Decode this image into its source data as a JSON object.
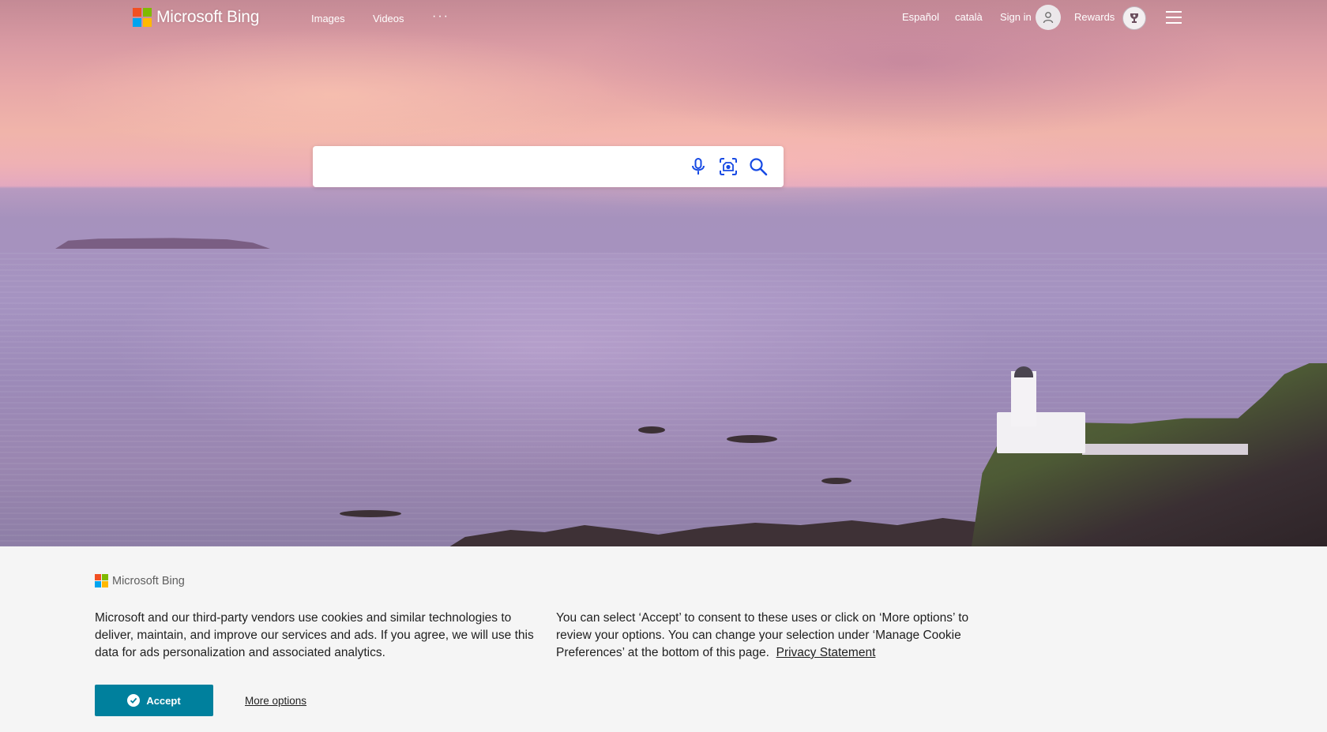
{
  "header": {
    "logo_text": "Microsoft Bing",
    "nav": {
      "images": "Images",
      "videos": "Videos",
      "more": "···"
    },
    "languages": [
      "Español",
      "català"
    ],
    "sign_in": "Sign in",
    "rewards": "Rewards"
  },
  "search": {
    "value": "",
    "icons": [
      "microphone-icon",
      "visual-search-icon",
      "search-icon"
    ]
  },
  "cookie_banner": {
    "logo_text": "Microsoft Bing",
    "paragraph_left": "Microsoft and our third-party vendors use cookies and similar technologies to deliver, maintain, and improve our services and ads. If you agree, we will use this data for ads personalization and associated analytics.",
    "paragraph_right": "You can select ‘Accept’ to consent to these uses or click on ‘More options’ to review your options.  You can change your selection under ‘Manage Cookie Preferences’ at the bottom of this page.",
    "privacy_link": "Privacy Statement",
    "accept_label": "Accept",
    "more_options_label": "More options"
  },
  "colors": {
    "accept_button": "#00809d",
    "ms_red": "#f25022",
    "ms_green": "#7fba00",
    "ms_blue": "#00a4ef",
    "ms_yellow": "#ffb900",
    "search_icon": "#174ae4"
  }
}
